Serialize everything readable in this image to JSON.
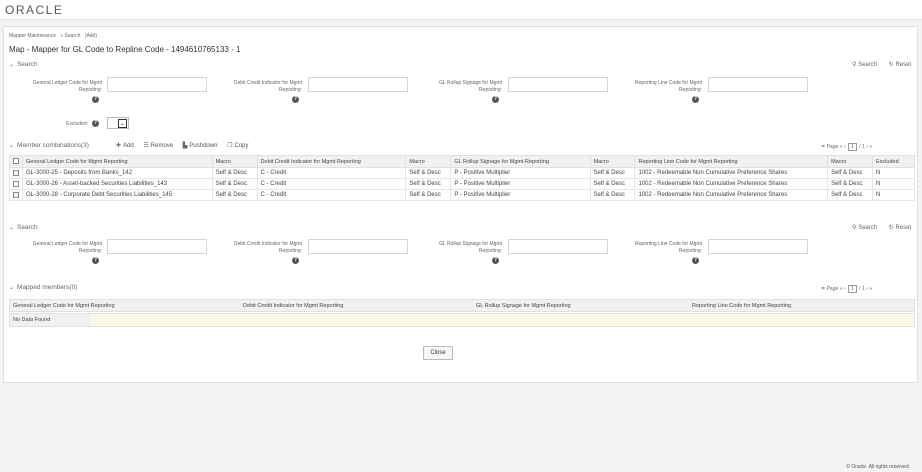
{
  "brand": {
    "logo": "ORACLE"
  },
  "breadcrumb": [
    "Mapper Maintenance",
    "» Search",
    "(Add)"
  ],
  "title": "Map - Mapper for GL Code to Repline Code - 1494610765133 - 1",
  "search1": {
    "header": "Search",
    "search_btn": "Search",
    "reset_btn": "Reset",
    "fields": [
      {
        "label1": "General Ledger Code for Mgmt",
        "label2": "Reporting:"
      },
      {
        "label1": "Debit Credit Indicator for Mgmt",
        "label2": "Reporting:"
      },
      {
        "label1": "GL Rollup Signage for Mgmt",
        "label2": "Reporting:"
      },
      {
        "label1": "Reporting Line Code for Mgmt",
        "label2": "Reporting:"
      }
    ],
    "excluded_label": "Excluded:"
  },
  "members": {
    "header": "Member combinations(3)",
    "toolbar": {
      "add": "Add",
      "remove": "Remove",
      "pushdown": "Pushdown",
      "copy": "Copy"
    },
    "pager": {
      "label": "Page",
      "current": "1",
      "total": "/ 1"
    },
    "columns": [
      "General Ledger Code for Mgmt Reporting",
      "Macro",
      "Debit Credit Indicator for Mgmt Reporting",
      "Macro",
      "GL Rollup Signage for Mgmt Reporting",
      "Macro",
      "Reporting Line Code for Mgmt Reporting",
      "Macro",
      "Excluded"
    ],
    "rows": [
      [
        "GL-3000-25 - Deposits from Banks_142",
        "Self & Desc",
        "C - Credit",
        "Self & Desc",
        "P - Positive Multiplier",
        "Self & Desc",
        "1002 - Redeemable Non Cumulative Preference Shares",
        "Self & Desc",
        "N"
      ],
      [
        "GL-3000-26 - Asset-backed Securities Liabilities_143",
        "Self & Desc",
        "C - Credit",
        "Self & Desc",
        "P - Positive Multiplier",
        "Self & Desc",
        "1002 - Redeemable Non Cumulative Preference Shares",
        "Self & Desc",
        "N"
      ],
      [
        "GL-3000-28 - Corporate Debt Securities Liabilities_145",
        "Self & Desc",
        "C - Credit",
        "Self & Desc",
        "P - Positive Multiplier",
        "Self & Desc",
        "1002 - Redeemable Non Cumulative Preference Shares",
        "Self & Desc",
        "N"
      ]
    ]
  },
  "search2": {
    "header": "Search",
    "search_btn": "Search",
    "reset_btn": "Reset",
    "fields": [
      {
        "label1": "General Ledger Code for Mgmt",
        "label2": "Reporting:"
      },
      {
        "label1": "Debit Credit Indicator for Mgmt",
        "label2": "Reporting:"
      },
      {
        "label1": "GL Rollup Signage for Mgmt",
        "label2": "Reporting:"
      },
      {
        "label1": "Reporting Line Code for Mgmt",
        "label2": "Reporting:"
      }
    ]
  },
  "mapped": {
    "header": "Mapped members(0)",
    "pager": {
      "label": "Page",
      "current": "1",
      "total": "/ 1"
    },
    "columns": [
      "General Ledger Code for Mgmt Reporting",
      "Debit Credit Indicator for Mgmt Reporting",
      "GL Rollup Signage for Mgmt Reporting",
      "Reporting Line Code for Mgmt Reporting"
    ],
    "empty": "No Data Found"
  },
  "close_label": "Close",
  "footer": "© Oracle. All rights reserved."
}
